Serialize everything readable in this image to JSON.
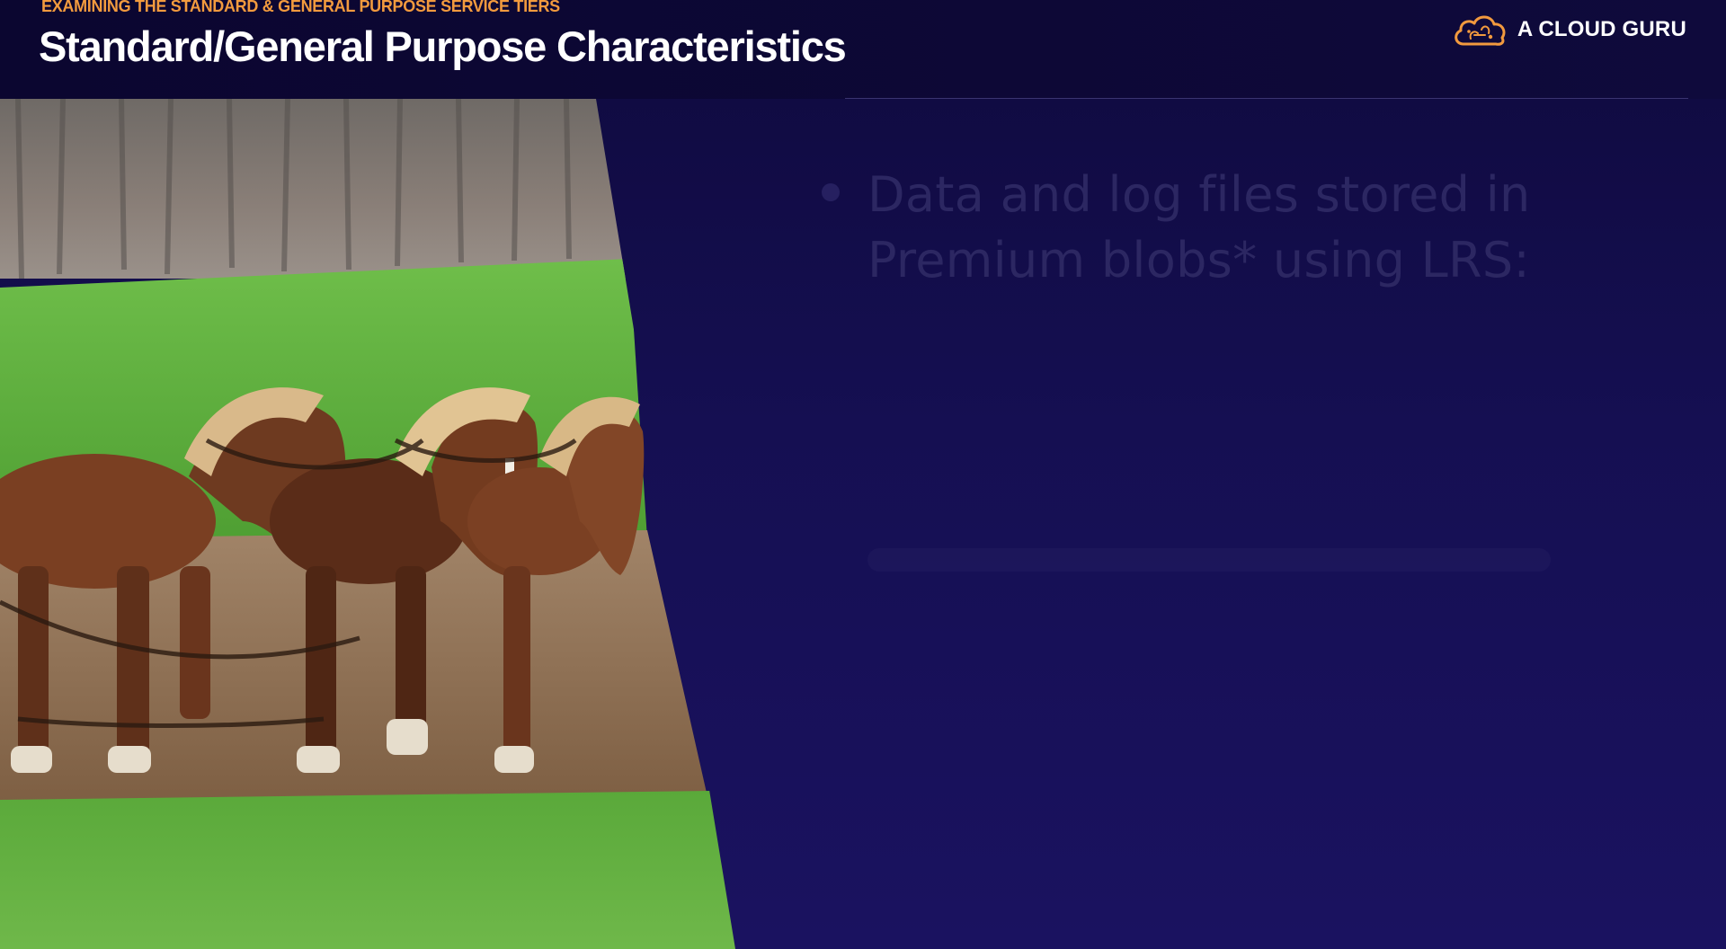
{
  "slide": {
    "eyebrow": "EXAMINING THE STANDARD & GENERAL PURPOSE SERVICE TIERS",
    "title": "Standard/General Purpose Characteristics",
    "brand_name": "A CLOUD GURU",
    "bullets": [
      {
        "text": "Data and log files stored in Premium blobs* using LRS:"
      }
    ]
  },
  "colors": {
    "background": "#150f52",
    "header": "#0b0630",
    "accent": "#f29a3e",
    "title": "#ffffff",
    "bullet_text": "#2c2762"
  },
  "icons": {
    "brand_logo": "cloud-logo-icon",
    "bullet": "bullet-dot-icon"
  },
  "image": {
    "subject": "draft-horses-plowing-field"
  }
}
